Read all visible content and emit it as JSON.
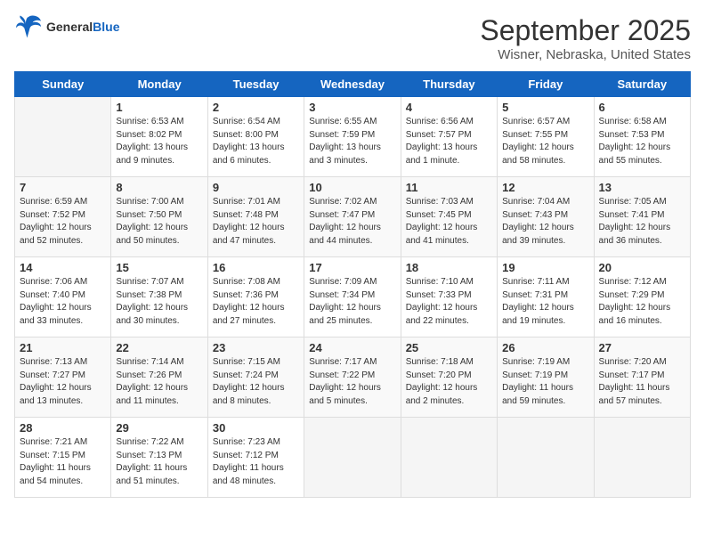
{
  "header": {
    "logo_line1": "General",
    "logo_line2": "Blue",
    "title": "September 2025",
    "subtitle": "Wisner, Nebraska, United States"
  },
  "days_of_week": [
    "Sunday",
    "Monday",
    "Tuesday",
    "Wednesday",
    "Thursday",
    "Friday",
    "Saturday"
  ],
  "weeks": [
    [
      {
        "num": "",
        "info": ""
      },
      {
        "num": "1",
        "info": "Sunrise: 6:53 AM\nSunset: 8:02 PM\nDaylight: 13 hours\nand 9 minutes."
      },
      {
        "num": "2",
        "info": "Sunrise: 6:54 AM\nSunset: 8:00 PM\nDaylight: 13 hours\nand 6 minutes."
      },
      {
        "num": "3",
        "info": "Sunrise: 6:55 AM\nSunset: 7:59 PM\nDaylight: 13 hours\nand 3 minutes."
      },
      {
        "num": "4",
        "info": "Sunrise: 6:56 AM\nSunset: 7:57 PM\nDaylight: 13 hours\nand 1 minute."
      },
      {
        "num": "5",
        "info": "Sunrise: 6:57 AM\nSunset: 7:55 PM\nDaylight: 12 hours\nand 58 minutes."
      },
      {
        "num": "6",
        "info": "Sunrise: 6:58 AM\nSunset: 7:53 PM\nDaylight: 12 hours\nand 55 minutes."
      }
    ],
    [
      {
        "num": "7",
        "info": "Sunrise: 6:59 AM\nSunset: 7:52 PM\nDaylight: 12 hours\nand 52 minutes."
      },
      {
        "num": "8",
        "info": "Sunrise: 7:00 AM\nSunset: 7:50 PM\nDaylight: 12 hours\nand 50 minutes."
      },
      {
        "num": "9",
        "info": "Sunrise: 7:01 AM\nSunset: 7:48 PM\nDaylight: 12 hours\nand 47 minutes."
      },
      {
        "num": "10",
        "info": "Sunrise: 7:02 AM\nSunset: 7:47 PM\nDaylight: 12 hours\nand 44 minutes."
      },
      {
        "num": "11",
        "info": "Sunrise: 7:03 AM\nSunset: 7:45 PM\nDaylight: 12 hours\nand 41 minutes."
      },
      {
        "num": "12",
        "info": "Sunrise: 7:04 AM\nSunset: 7:43 PM\nDaylight: 12 hours\nand 39 minutes."
      },
      {
        "num": "13",
        "info": "Sunrise: 7:05 AM\nSunset: 7:41 PM\nDaylight: 12 hours\nand 36 minutes."
      }
    ],
    [
      {
        "num": "14",
        "info": "Sunrise: 7:06 AM\nSunset: 7:40 PM\nDaylight: 12 hours\nand 33 minutes."
      },
      {
        "num": "15",
        "info": "Sunrise: 7:07 AM\nSunset: 7:38 PM\nDaylight: 12 hours\nand 30 minutes."
      },
      {
        "num": "16",
        "info": "Sunrise: 7:08 AM\nSunset: 7:36 PM\nDaylight: 12 hours\nand 27 minutes."
      },
      {
        "num": "17",
        "info": "Sunrise: 7:09 AM\nSunset: 7:34 PM\nDaylight: 12 hours\nand 25 minutes."
      },
      {
        "num": "18",
        "info": "Sunrise: 7:10 AM\nSunset: 7:33 PM\nDaylight: 12 hours\nand 22 minutes."
      },
      {
        "num": "19",
        "info": "Sunrise: 7:11 AM\nSunset: 7:31 PM\nDaylight: 12 hours\nand 19 minutes."
      },
      {
        "num": "20",
        "info": "Sunrise: 7:12 AM\nSunset: 7:29 PM\nDaylight: 12 hours\nand 16 minutes."
      }
    ],
    [
      {
        "num": "21",
        "info": "Sunrise: 7:13 AM\nSunset: 7:27 PM\nDaylight: 12 hours\nand 13 minutes."
      },
      {
        "num": "22",
        "info": "Sunrise: 7:14 AM\nSunset: 7:26 PM\nDaylight: 12 hours\nand 11 minutes."
      },
      {
        "num": "23",
        "info": "Sunrise: 7:15 AM\nSunset: 7:24 PM\nDaylight: 12 hours\nand 8 minutes."
      },
      {
        "num": "24",
        "info": "Sunrise: 7:17 AM\nSunset: 7:22 PM\nDaylight: 12 hours\nand 5 minutes."
      },
      {
        "num": "25",
        "info": "Sunrise: 7:18 AM\nSunset: 7:20 PM\nDaylight: 12 hours\nand 2 minutes."
      },
      {
        "num": "26",
        "info": "Sunrise: 7:19 AM\nSunset: 7:19 PM\nDaylight: 11 hours\nand 59 minutes."
      },
      {
        "num": "27",
        "info": "Sunrise: 7:20 AM\nSunset: 7:17 PM\nDaylight: 11 hours\nand 57 minutes."
      }
    ],
    [
      {
        "num": "28",
        "info": "Sunrise: 7:21 AM\nSunset: 7:15 PM\nDaylight: 11 hours\nand 54 minutes."
      },
      {
        "num": "29",
        "info": "Sunrise: 7:22 AM\nSunset: 7:13 PM\nDaylight: 11 hours\nand 51 minutes."
      },
      {
        "num": "30",
        "info": "Sunrise: 7:23 AM\nSunset: 7:12 PM\nDaylight: 11 hours\nand 48 minutes."
      },
      {
        "num": "",
        "info": ""
      },
      {
        "num": "",
        "info": ""
      },
      {
        "num": "",
        "info": ""
      },
      {
        "num": "",
        "info": ""
      }
    ]
  ]
}
